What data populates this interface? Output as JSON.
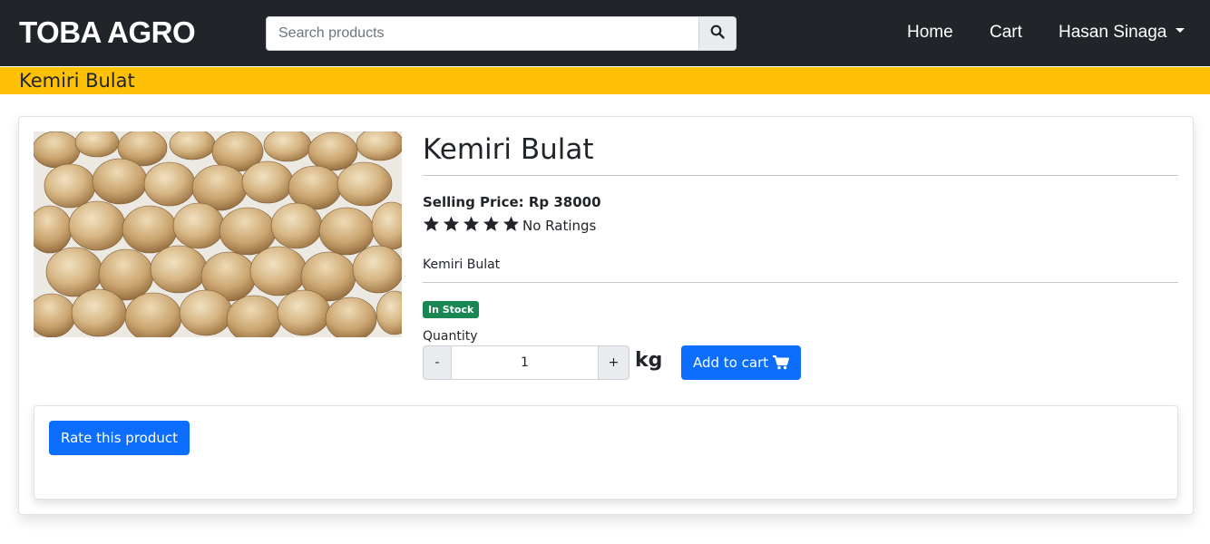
{
  "navbar": {
    "brand": "TOBA AGRO",
    "search_placeholder": "Search products",
    "search_icon": "search-icon",
    "links": {
      "home": "Home",
      "cart": "Cart",
      "user": "Hasan Sinaga"
    }
  },
  "subheader": {
    "title": "Kemiri Bulat"
  },
  "product": {
    "name": "Kemiri Bulat",
    "image_alt": "Kemiri Bulat",
    "price_label": "Selling Price: Rp 38000",
    "rating_stars": 5,
    "rating_text": "No Ratings",
    "description": "Kemiri Bulat",
    "stock_badge": "In Stock",
    "quantity_label": "Quantity",
    "quantity_value": "1",
    "decrement_label": "-",
    "increment_label": "+",
    "unit": "kg",
    "add_to_cart_label": "Add to cart",
    "cart_icon": "cart-icon"
  },
  "rating_section": {
    "rate_button_label": "Rate this product"
  },
  "colors": {
    "navbar_bg": "#212529",
    "subheader_bg": "#ffc107",
    "primary": "#0d6efd",
    "success": "#198754"
  }
}
